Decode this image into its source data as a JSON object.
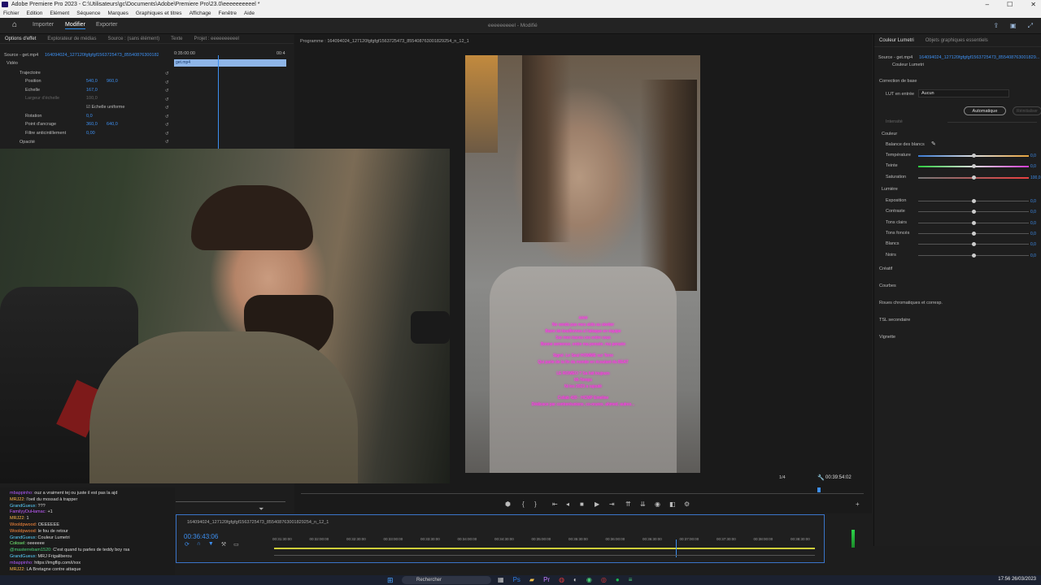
{
  "window": {
    "title": "Adobe Premiere Pro 2023 - C:\\Utilisateurs\\gc\\Documents\\Adobe\\Premiere Pro\\23.0\\eeeeeeeeeel *"
  },
  "menu": [
    "Fichier",
    "Edition",
    "Elément",
    "Séquence",
    "Marques",
    "Graphiques et titres",
    "Affichage",
    "Fenêtre",
    "Aide"
  ],
  "workspace": {
    "tabs": [
      "Importer",
      "Modifier",
      "Exporter"
    ],
    "active_tab": "Modifier",
    "center_title": "eeeeeeeeel - Modifié"
  },
  "effect_controls": {
    "tabs": [
      "Options d'effet",
      "Explorateur de médias",
      "Source : (sans élément)",
      "Texte",
      "Projet : eeeeeeeeeel"
    ],
    "source_label": "Source - get.mp4",
    "sequence_label": "164094024_127120fgfgfgf1563725473_855408763001829254_n_12_1 * get.mp4",
    "section_video": "Vidéo",
    "timecode_top": "0:35:00:00",
    "timecode_right": "00:4",
    "clip_name": "get.mp4",
    "params": [
      {
        "name": "Trajectoire",
        "v1": "",
        "v2": ""
      },
      {
        "name": "Position",
        "v1": "540,0",
        "v2": "960,0"
      },
      {
        "name": "Echelle",
        "v1": "167,0",
        "v2": ""
      },
      {
        "name": "Largeur d'échelle",
        "v1": "100,0",
        "v2": ""
      },
      {
        "name": "Echelle uniforme",
        "v1": "",
        "v2": ""
      },
      {
        "name": "Rotation",
        "v1": "0,0",
        "v2": ""
      },
      {
        "name": "Point d'ancrage",
        "v1": "360,0",
        "v2": "640,0"
      },
      {
        "name": "Filtre anticintillement",
        "v1": "0,00",
        "v2": ""
      },
      {
        "name": "Opacité",
        "v1": "",
        "v2": ""
      }
    ]
  },
  "program_monitor": {
    "label": "Programme : 164094024_127120fgfgfgf1563725473_855408763001829254_n_12_1",
    "zoom": "1/4",
    "duration": "00:39:54:02",
    "subtitle_lines": [
      "####",
      "Ne vends pas mes skits au sketter",
      "Barre de bouffonnes à l'attaque en équipe",
      "Sur mes traces ces entre vous",
      "Bonne semence, entre ma pensée, ma pensée",
      "",
      "Signé. Le Seul HOMME sur Terre",
      "Qui parle de la fin du monde en écoutant du BEAT",
      "",
      "LE ROMEO ? Sa fait toujours",
      "Mi-Temps",
      "Ni les 2023 a rajouté",
      "",
      "Collab 420 - HCMP Emeline",
      "Dédicace par contreréunions, co-orures, ahmed, autres..."
    ]
  },
  "lumetri": {
    "tabs": [
      "Couleur Lumetri",
      "Objets graphiques essentiels"
    ],
    "source": "Source - get.mp4",
    "sequence": "164094024_127120fgfgfgf1563725473_855408763001829...",
    "fx_label": "Couleur Lumetri",
    "section_base": "Correction de base",
    "lut_label": "LUT en entrée",
    "lut_value": "Aucun",
    "auto_button": "Automatique",
    "reset_button": "Réinitialiser",
    "intensity_label": "Intensité",
    "couleur_label": "Couleur",
    "wb_label": "Balance des blancs",
    "lumiere_label": "Lumière",
    "color_sliders": [
      {
        "name": "Température",
        "value": "0,0",
        "pos": 0.5
      },
      {
        "name": "Teinte",
        "value": "0,0",
        "pos": 0.5
      },
      {
        "name": "Saturation",
        "value": "100,0",
        "pos": 0.5
      }
    ],
    "light_sliders": [
      {
        "name": "Exposition",
        "value": "0,0",
        "pos": 0.5
      },
      {
        "name": "Contraste",
        "value": "0,0",
        "pos": 0.5
      },
      {
        "name": "Tons clairs",
        "value": "0,0",
        "pos": 0.5
      },
      {
        "name": "Tons foncés",
        "value": "0,0",
        "pos": 0.5
      },
      {
        "name": "Blancs",
        "value": "0,0",
        "pos": 0.5
      },
      {
        "name": "Noirs",
        "value": "0,0",
        "pos": 0.5
      }
    ],
    "sections": [
      "Créatif",
      "Courbes",
      "Roues chromatiques et corresp.",
      "TSL secondaire",
      "Vignette"
    ]
  },
  "timeline": {
    "sequence_name": "164094024_127120fgfgfgf1563725473_855408763001829254_n_12_1",
    "timecode": "00:36:43:06",
    "ruler": [
      "00:31:30:00",
      "00:32:00:00",
      "00:32:30:00",
      "00:33:00:00",
      "00:33:30:00",
      "00:34:00:00",
      "00:34:30:00",
      "00:35:00:00",
      "00:35:30:00",
      "00:36:00:00",
      "00:36:30:00",
      "00:37:00:00",
      "00:37:30:00",
      "00:38:00:00",
      "00:38:30:00"
    ]
  },
  "chat": [
    {
      "user": "mbappinho",
      "color": "#b25cff",
      "text": "ouz a vraiment tej ou juste il est pas la ajd"
    },
    {
      "user": "MRJ22",
      "color": "#ffb84a",
      "text": "l'oeil du mossad à trapper"
    },
    {
      "user": "GrandGueux",
      "color": "#5ad1ff",
      "text": "???"
    },
    {
      "user": "FamilyyDuHamac",
      "color": "#c15cff",
      "text": "+1"
    },
    {
      "user": "MRJ22",
      "color": "#ffb84a",
      "text": "1"
    },
    {
      "user": "Wooldpwood",
      "color": "#ff8b3d",
      "text": "OEEEEEE"
    },
    {
      "user": "Wooldpwood",
      "color": "#ff8b3d",
      "text": "le fou de retour"
    },
    {
      "user": "GrandGueux",
      "color": "#5ad1ff",
      "text": "Couleur Lumetri"
    },
    {
      "user": "Colosel",
      "color": "#7cff7c",
      "text": "oeeeeee"
    },
    {
      "user": "@masterrebam1520",
      "color": "#4ad37a",
      "text": "C'est quand tu parles de teddy boy rsa"
    },
    {
      "user": "GrandGueux",
      "color": "#5ad1ff",
      "text": "MRJ Frigaliberou"
    },
    {
      "user": "mbappinho",
      "color": "#b25cff",
      "text": "https://imgflip.com/i/xxx"
    },
    {
      "user": "MRJ22",
      "color": "#ffb84a",
      "text": "LA Bretagne contre attaque"
    }
  ],
  "taskbar": {
    "search_placeholder": "Rechercher",
    "time": "17:56",
    "date": "26/03/2023"
  }
}
